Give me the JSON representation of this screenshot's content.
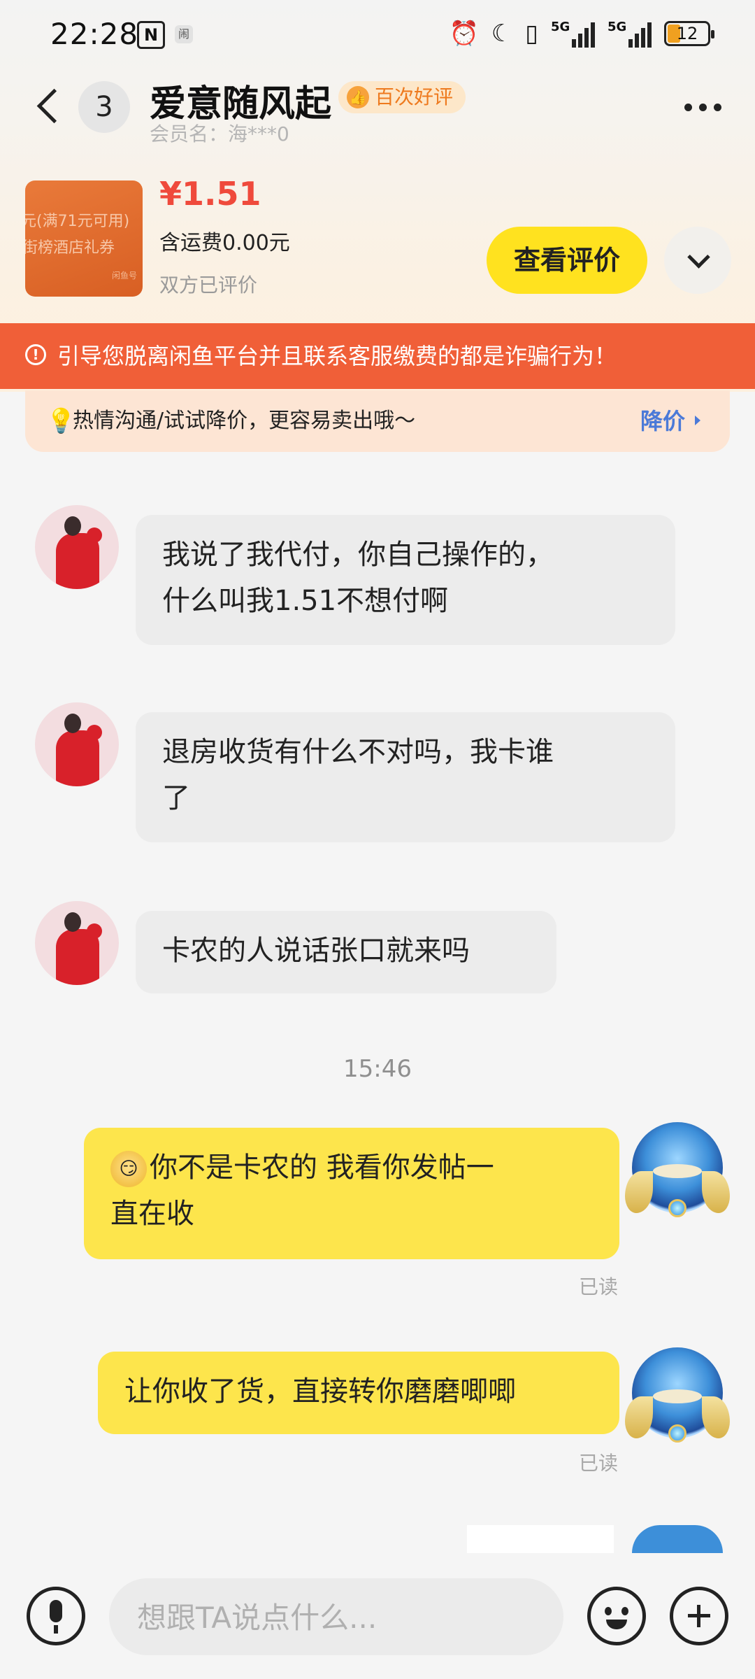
{
  "status_bar": {
    "time": "22:28",
    "n_icon": "N",
    "app_icon": "闹",
    "net1": "5G",
    "net2": "5G",
    "battery": "12"
  },
  "header": {
    "unread_count": "3",
    "title": "爱意随风起",
    "badge": "百次好评",
    "member": "会员名：海***0"
  },
  "product": {
    "image_text_1": "元(满71元可用)",
    "image_text_2": "街榜酒店礼券",
    "image_text_3": "闲鱼号",
    "price": "¥1.51",
    "shipping": "含运费0.00元",
    "review_status": "双方已评价",
    "view_review_button": "查看评价"
  },
  "warning": {
    "icon": "!",
    "text": "引导您脱离闲鱼平台并且联系客服缴费的都是诈骗行为！"
  },
  "tip": {
    "text": "热情沟通/试试降价，更容易卖出哦～",
    "action": "降价"
  },
  "messages": [
    {
      "direction": "in",
      "text_line1": "我说了我代付，你自己操作的，",
      "text_line2": "什么叫我1.51不想付啊"
    },
    {
      "direction": "in",
      "text_line1": "退房收货有什么不对吗，我卡谁",
      "text_line2": "了"
    },
    {
      "direction": "in",
      "text_line1": "卡农的人说话张口就来吗"
    },
    {
      "direction": "out",
      "emoji": "😏",
      "text_line1": "你不是卡农的  我看你发帖一",
      "text_line2": "直在收",
      "read": "已读"
    },
    {
      "direction": "out",
      "text_line1": "让你收了货，直接转你磨磨唧唧",
      "read": "已读"
    }
  ],
  "timestamp": "15:46",
  "input": {
    "placeholder": "想跟TA说点什么..."
  }
}
